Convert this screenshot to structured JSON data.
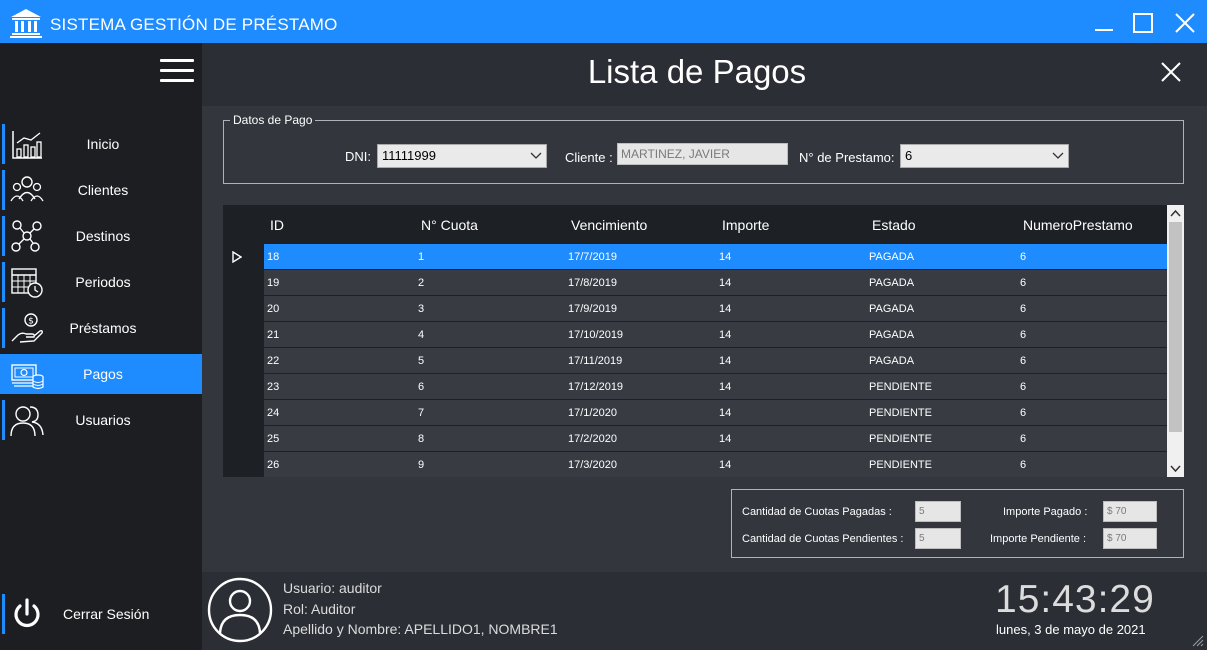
{
  "window": {
    "title": "SISTEMA GESTIÓN DE PRÉSTAMO",
    "icons": [
      "bank-icon",
      "minimize-icon",
      "maximize-icon",
      "close-icon"
    ]
  },
  "sidebar": {
    "items": [
      {
        "label": "Inicio",
        "icon": "chart-icon",
        "active": false
      },
      {
        "label": "Clientes",
        "icon": "users-group-icon",
        "active": false
      },
      {
        "label": "Destinos",
        "icon": "network-icon",
        "active": false
      },
      {
        "label": "Periodos",
        "icon": "calendar-clock-icon",
        "active": false
      },
      {
        "label": "Préstamos",
        "icon": "hand-money-icon",
        "active": false
      },
      {
        "label": "Pagos",
        "icon": "cash-icon",
        "active": true
      },
      {
        "label": "Usuarios",
        "icon": "users-icon",
        "active": false
      }
    ],
    "logout_label": "Cerrar Sesión"
  },
  "page": {
    "title": "Lista de Pagos"
  },
  "filters": {
    "group_title": "Datos de Pago",
    "dni_label": "DNI:",
    "dni_value": "11111999",
    "cliente_label": "Cliente :",
    "cliente_value": "MARTINEZ, JAVIER",
    "prestamo_label": "N° de Prestamo:",
    "prestamo_value": "6"
  },
  "grid": {
    "columns": [
      "ID",
      "N° Cuota",
      "Vencimiento",
      "Importe",
      "Estado",
      "NumeroPrestamo"
    ],
    "selected_index": 0,
    "rows": [
      [
        "18",
        "1",
        "17/7/2019",
        "14",
        "PAGADA",
        "6"
      ],
      [
        "19",
        "2",
        "17/8/2019",
        "14",
        "PAGADA",
        "6"
      ],
      [
        "20",
        "3",
        "17/9/2019",
        "14",
        "PAGADA",
        "6"
      ],
      [
        "21",
        "4",
        "17/10/2019",
        "14",
        "PAGADA",
        "6"
      ],
      [
        "22",
        "5",
        "17/11/2019",
        "14",
        "PAGADA",
        "6"
      ],
      [
        "23",
        "6",
        "17/12/2019",
        "14",
        "PENDIENTE",
        "6"
      ],
      [
        "24",
        "7",
        "17/1/2020",
        "14",
        "PENDIENTE",
        "6"
      ],
      [
        "25",
        "8",
        "17/2/2020",
        "14",
        "PENDIENTE",
        "6"
      ],
      [
        "26",
        "9",
        "17/3/2020",
        "14",
        "PENDIENTE",
        "6"
      ]
    ]
  },
  "summary": {
    "pagadas_label": "Cantidad de Cuotas Pagadas :",
    "pagadas_value": "5",
    "pendientes_label": "Cantidad de Cuotas Pendientes :",
    "pendientes_value": "5",
    "importe_pagado_label": "Importe Pagado :",
    "importe_pagado_value": "$ 70",
    "importe_pendiente_label": "Importe Pendiente :",
    "importe_pendiente_value": "$ 70"
  },
  "user": {
    "usuario": "Usuario: auditor",
    "rol": "Rol: Auditor",
    "nombre": "Apellido y Nombre: APELLIDO1, NOMBRE1"
  },
  "clock": {
    "time": "15:43:29",
    "date": "lunes, 3 de mayo de 2021"
  },
  "colors": {
    "accent": "#1e8bff",
    "sidebar": "#1c1e22",
    "panel": "#33363d",
    "row": "#383b42"
  }
}
